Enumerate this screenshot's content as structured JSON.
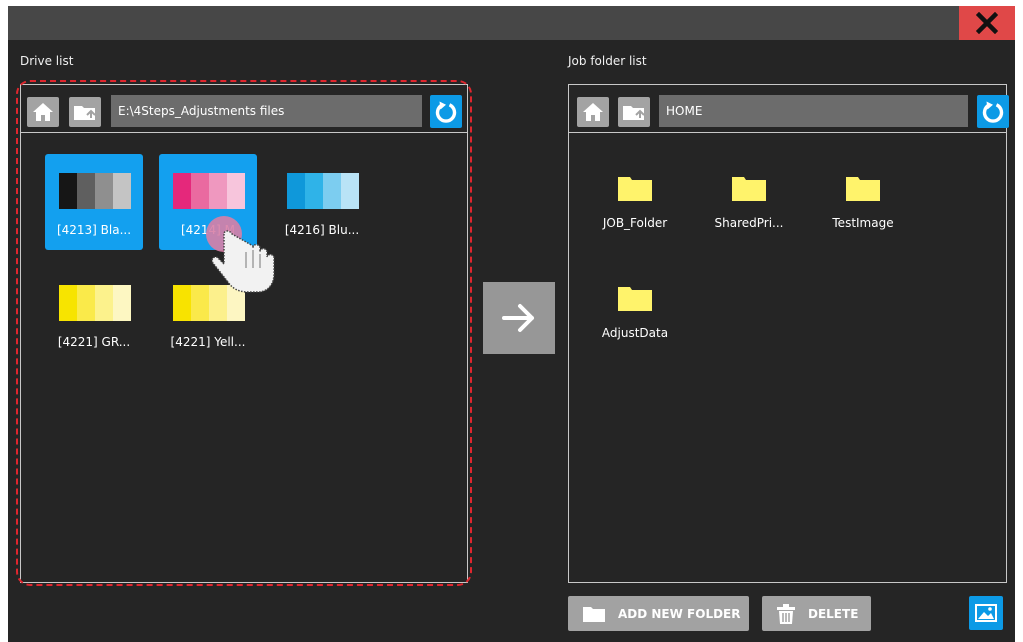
{
  "window": {
    "close_icon": "close-icon"
  },
  "drive_panel": {
    "label": "Drive list",
    "path": "E:\\4Steps_Adjustments files",
    "items": [
      {
        "label": "[4213] Bla...",
        "selected": true,
        "colors": [
          "#161616",
          "#5f5f5f",
          "#8f8f8f",
          "#c4c4c4"
        ]
      },
      {
        "label": "[4214] M",
        "selected": true,
        "colors": [
          "#e5287b",
          "#ea6aa0",
          "#ef98bf",
          "#f7c5dc"
        ]
      },
      {
        "label": "[4216] Blu...",
        "selected": false,
        "colors": [
          "#0f98da",
          "#2fb3e8",
          "#7ccdf0",
          "#b9e3f6"
        ]
      },
      {
        "label": "[4221] GR...",
        "selected": false,
        "colors": [
          "#f7e400",
          "#faea4a",
          "#fcf28c",
          "#fdf7c2"
        ]
      },
      {
        "label": "[4221] Yell...",
        "selected": false,
        "colors": [
          "#f8e300",
          "#fae94a",
          "#fcf08c",
          "#fdf6c2"
        ]
      }
    ]
  },
  "job_panel": {
    "label": "Job folder list",
    "path": "HOME",
    "folders": [
      {
        "label": "JOB_Folder"
      },
      {
        "label": "SharedPri..."
      },
      {
        "label": "TestImage"
      },
      {
        "label": "AdjustData"
      }
    ]
  },
  "actions": {
    "add_folder_label": "ADD NEW FOLDER",
    "delete_label": "DELETE"
  },
  "colors": {
    "accent": "#0c9ae6",
    "close": "#e04848",
    "selection_outline": "#e0262e",
    "folder": "#fff36b"
  }
}
